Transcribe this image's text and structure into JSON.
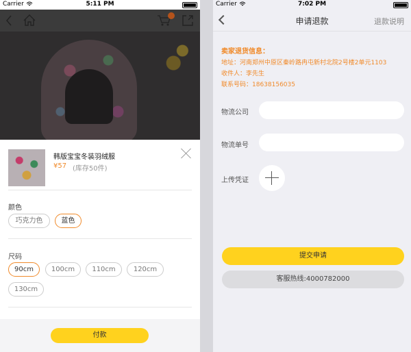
{
  "left": {
    "status": {
      "carrier": "Carrier",
      "time": "5:11 PM"
    },
    "nav": {
      "cart_badge": "2"
    },
    "product": {
      "title": "韩版宝宝冬装羽绒服",
      "price": "¥57",
      "stock": "(库存50件)"
    },
    "color": {
      "label": "颜色",
      "options": [
        "巧克力色",
        "蓝色"
      ],
      "selected": "蓝色"
    },
    "size": {
      "label": "尺码",
      "options": [
        "90cm",
        "100cm",
        "110cm",
        "120cm",
        "130cm"
      ],
      "selected": "90cm"
    },
    "pay_label": "付款"
  },
  "right": {
    "status": {
      "carrier": "Carrier",
      "time": "7:02 PM"
    },
    "nav": {
      "title": "申请退款",
      "right_label": "退款说明"
    },
    "seller": {
      "heading": "卖家退货信息：",
      "address": "地址：河南郑州中原区秦岭路冉屯新村北院2号楼2单元1103",
      "contact": "收件人：李先生",
      "phone": "联系号码：18638156035"
    },
    "form": {
      "logistics_company_label": "物流公司",
      "logistics_company_value": "",
      "tracking_number_label": "物流单号",
      "tracking_number_value": "",
      "upload_label": "上传凭证"
    },
    "submit_label": "提交申请",
    "hotline_label": "客服热线:4000782000"
  },
  "colors": {
    "accent_yellow": "#ffd21e",
    "accent_orange": "#f08a2a"
  },
  "icons": [
    "back-icon",
    "home-icon",
    "cart-icon",
    "share-icon",
    "close-icon",
    "plus-icon",
    "wifi-icon",
    "battery-icon"
  ]
}
